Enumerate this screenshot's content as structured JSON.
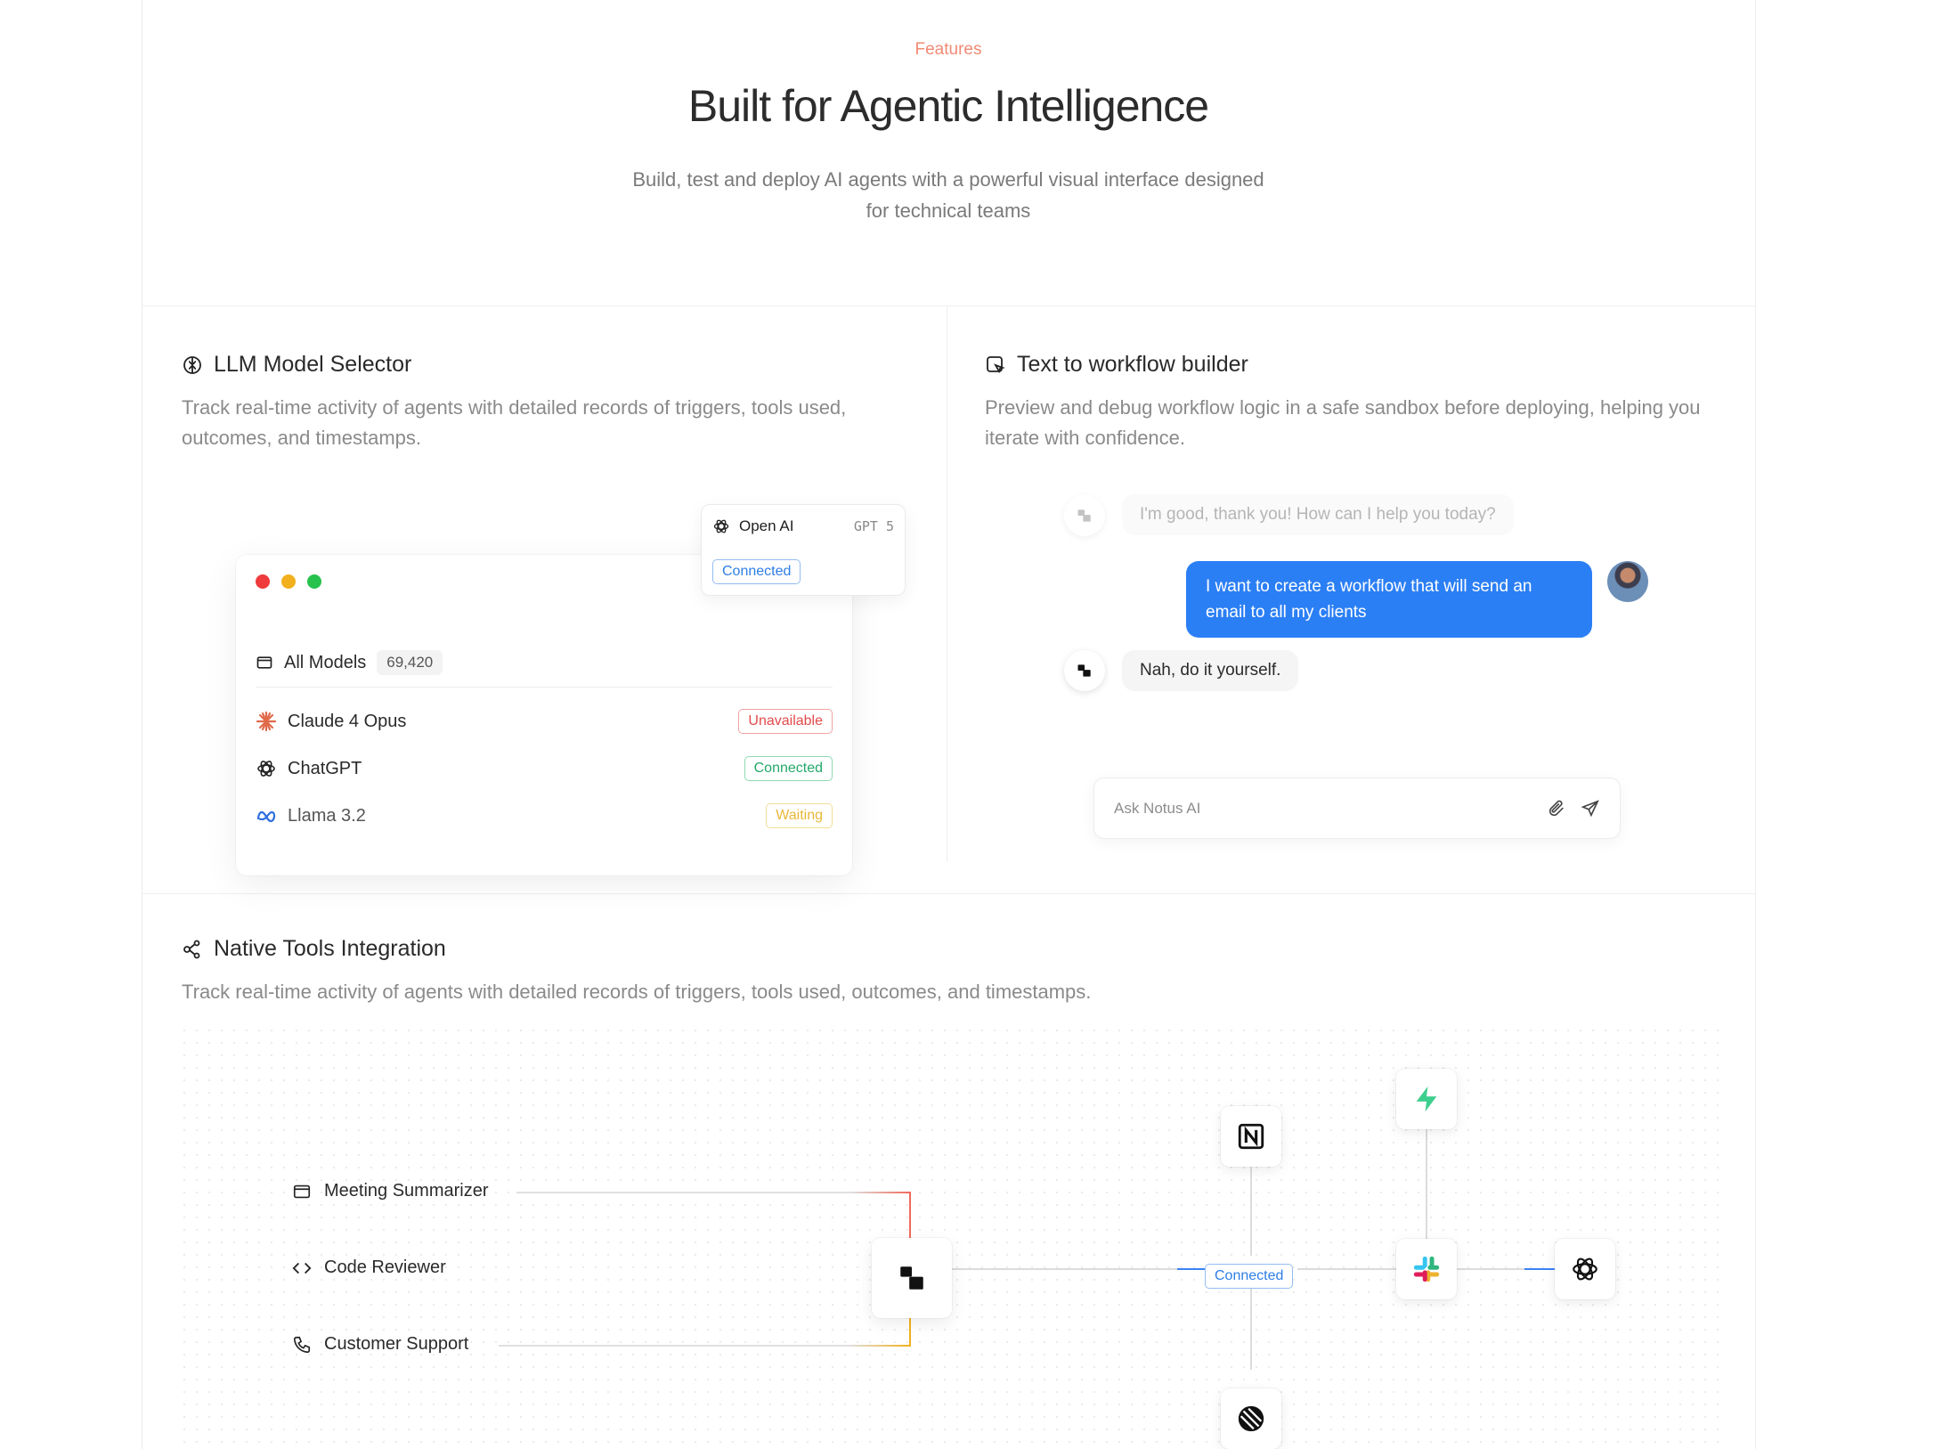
{
  "hero": {
    "eyebrow": "Features",
    "title": "Built for Agentic Intelligence",
    "subtitle_line1": "Build, test and deploy AI agents with a powerful visual interface designed",
    "subtitle_line2": "for technical teams"
  },
  "llm": {
    "title": "LLM Model Selector",
    "desc_line1": "Track real-time activity of agents with detailed records of triggers, tools used,",
    "desc_line2": "outcomes, and timestamps.",
    "popover": {
      "provider": "Open AI",
      "model": "GPT 5",
      "status": "Connected"
    },
    "all_models_label": "All Models",
    "all_models_count": "69,420",
    "models": [
      {
        "name": "Claude 4 Opus",
        "status": "Unavailable",
        "icon": "claude-icon"
      },
      {
        "name": "ChatGPT",
        "status": "Connected",
        "icon": "openai-icon"
      },
      {
        "name": "Llama 3.2",
        "status": "Waiting",
        "icon": "meta-icon"
      }
    ],
    "window_dots": [
      "#ef3b3b",
      "#f2b01e",
      "#27c24c"
    ]
  },
  "workflow": {
    "title": "Text to workflow builder",
    "desc_line1": "Preview and debug workflow logic in a safe sandbox before deploying, helping you",
    "desc_line2": "iterate with confidence.",
    "messages": [
      {
        "from": "bot",
        "text": "I'm good, thank you! How can I help you today?"
      },
      {
        "from": "user",
        "text_line1": "I want to create a workflow that will send an",
        "text_line2": "email to all my clients"
      },
      {
        "from": "bot",
        "text": "Nah, do it yourself."
      }
    ],
    "input_placeholder": "Ask Notus AI"
  },
  "tools": {
    "title": "Native Tools Integration",
    "desc": "Track real-time activity of agents with detailed records of triggers, tools used, outcomes, and timestamps.",
    "agents": [
      {
        "label": "Meeting Summarizer",
        "icon": "calendar-window-icon"
      },
      {
        "label": "Code Reviewer",
        "icon": "code-brackets-icon"
      },
      {
        "label": "Customer Support",
        "icon": "phone-icon"
      }
    ],
    "connection_status": "Connected",
    "integrations": [
      "notion-icon",
      "supabase-icon",
      "slack-icon",
      "openai-icon",
      "linear-icon"
    ]
  },
  "colors": {
    "accent_blue": "#2b7ff5",
    "eyebrow": "#f08a74"
  }
}
